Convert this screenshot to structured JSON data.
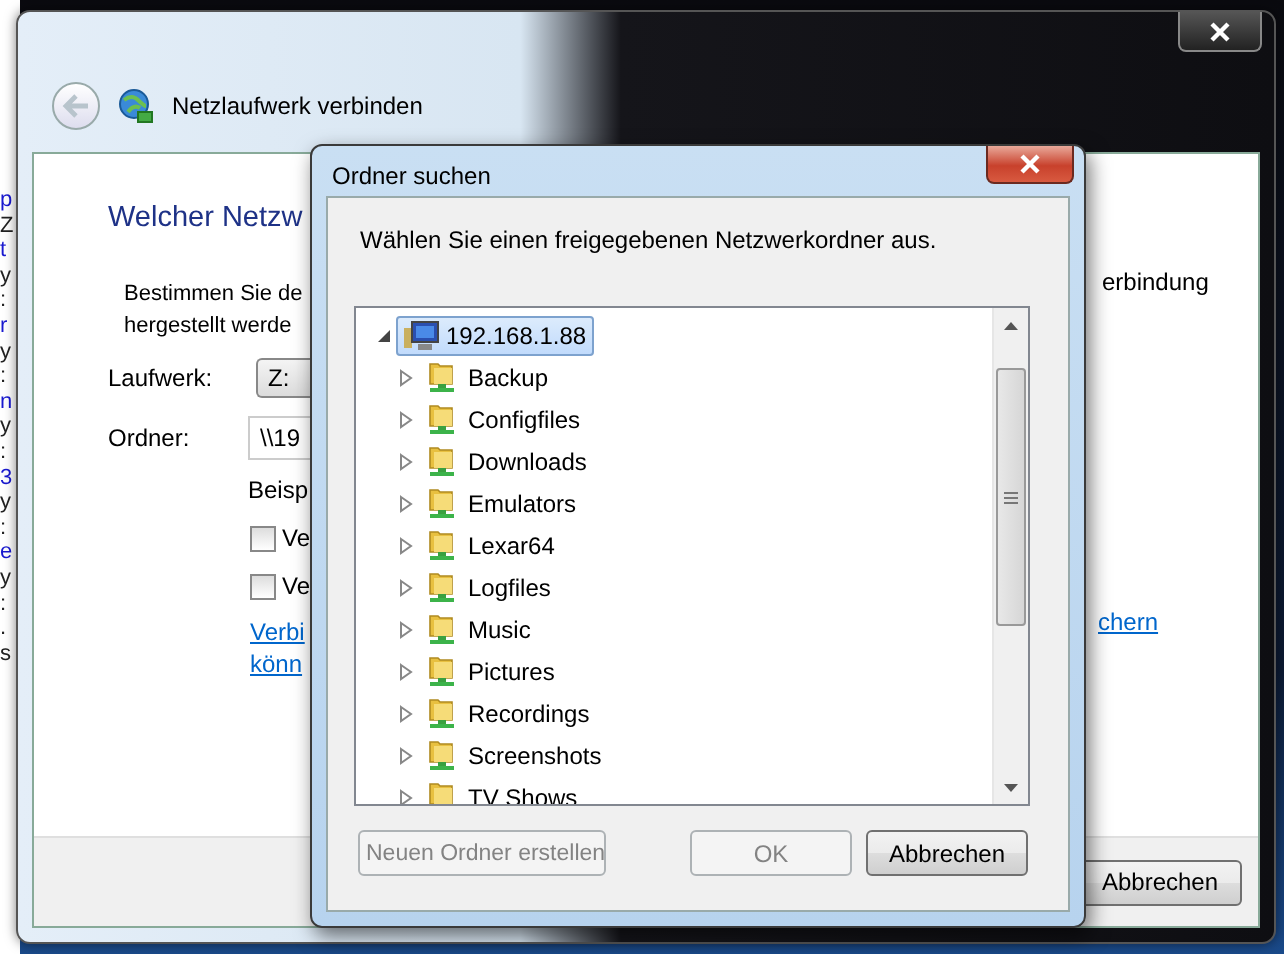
{
  "background_window": {
    "fragments": [
      {
        "text": "p",
        "kind": "link"
      },
      {
        "text": "Z",
        "kind": "text"
      },
      {
        "text": "t",
        "kind": "link"
      },
      {
        "text": "y",
        "kind": "text"
      },
      {
        "text": ":",
        "kind": "text"
      },
      {
        "text": "r",
        "kind": "link"
      },
      {
        "text": "y",
        "kind": "text"
      },
      {
        "text": ":",
        "kind": "text"
      },
      {
        "text": "n",
        "kind": "link"
      },
      {
        "text": "y",
        "kind": "text"
      },
      {
        "text": ":",
        "kind": "text"
      },
      {
        "text": "3",
        "kind": "link"
      },
      {
        "text": "y",
        "kind": "text"
      },
      {
        "text": ":",
        "kind": "text"
      },
      {
        "text": "e",
        "kind": "link"
      },
      {
        "text": "y",
        "kind": "text"
      },
      {
        "text": ":",
        "kind": "text"
      },
      {
        "text": ".",
        "kind": "text"
      },
      {
        "text": "s",
        "kind": "text"
      }
    ]
  },
  "wizard": {
    "title": "Netzlaufwerk verbinden",
    "heading": "Welcher Netzw",
    "intro_lines": [
      "Bestimmen Sie de",
      "hergestellt werde"
    ],
    "intro_right": "erbindung",
    "drive": {
      "label": "Laufwerk:",
      "value": "Z:"
    },
    "folder": {
      "label": "Ordner:",
      "value": "\\\\19"
    },
    "example": "Beisp",
    "checkboxes": [
      {
        "label": "Ve",
        "checked": false
      },
      {
        "label": "Ve",
        "checked": false
      }
    ],
    "link_lines": [
      "Verbi",
      "könn"
    ],
    "link_right": "chern",
    "cancel": "Abbrechen"
  },
  "dialog": {
    "title": "Ordner suchen",
    "description": "Wählen Sie einen freigegebenen Netzwerkordner aus.",
    "tree": {
      "label": "192.168.1.88",
      "expanded": true,
      "selected": true,
      "children": [
        {
          "label": "Backup",
          "expanded": false,
          "selected": false
        },
        {
          "label": "Configfiles",
          "expanded": false,
          "selected": false
        },
        {
          "label": "Downloads",
          "expanded": false,
          "selected": false
        },
        {
          "label": "Emulators",
          "expanded": false,
          "selected": false
        },
        {
          "label": "Lexar64",
          "expanded": false,
          "selected": false
        },
        {
          "label": "Logfiles",
          "expanded": false,
          "selected": false
        },
        {
          "label": "Music",
          "expanded": false,
          "selected": false
        },
        {
          "label": "Pictures",
          "expanded": false,
          "selected": false
        },
        {
          "label": "Recordings",
          "expanded": false,
          "selected": false
        },
        {
          "label": "Screenshots",
          "expanded": false,
          "selected": false
        },
        {
          "label": "TV Shows",
          "expanded": false,
          "selected": false
        }
      ]
    },
    "buttons": [
      {
        "label": "Neuen Ordner erstellen",
        "disabled": true,
        "kind": "left"
      },
      {
        "label": "OK",
        "disabled": true,
        "kind": "right"
      },
      {
        "label": "Abbrechen",
        "disabled": false,
        "kind": "right"
      }
    ]
  }
}
